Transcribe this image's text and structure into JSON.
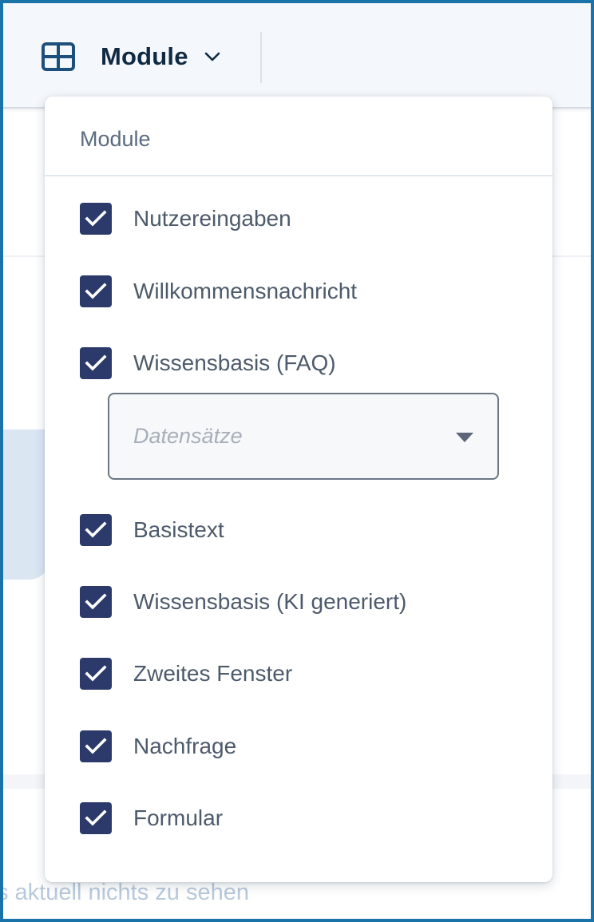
{
  "topbar": {
    "menu_label": "Module",
    "icons": {
      "grid": "grid-icon",
      "chevron": "chevron-down-icon"
    }
  },
  "background": {
    "empty_text": "s aktuell nichts zu sehen"
  },
  "dropdown": {
    "title": "Module",
    "options": [
      {
        "label": "Nutzereingaben",
        "checked": true
      },
      {
        "label": "Willkommensnachricht",
        "checked": true
      },
      {
        "label": "Wissensbasis (FAQ)",
        "checked": true
      },
      {
        "label": "Basistext",
        "checked": true
      },
      {
        "label": "Wissensbasis (KI generiert)",
        "checked": true
      },
      {
        "label": "Zweites Fenster",
        "checked": true
      },
      {
        "label": "Nachfrage",
        "checked": true
      },
      {
        "label": "Formular",
        "checked": true
      }
    ],
    "faq_select": {
      "placeholder": "Datensätze"
    }
  },
  "colors": {
    "checkbox": "#2b3a6b",
    "icon_blue": "#1d4f7c",
    "frame": "#1a73a8",
    "title_text": "#102a43"
  }
}
